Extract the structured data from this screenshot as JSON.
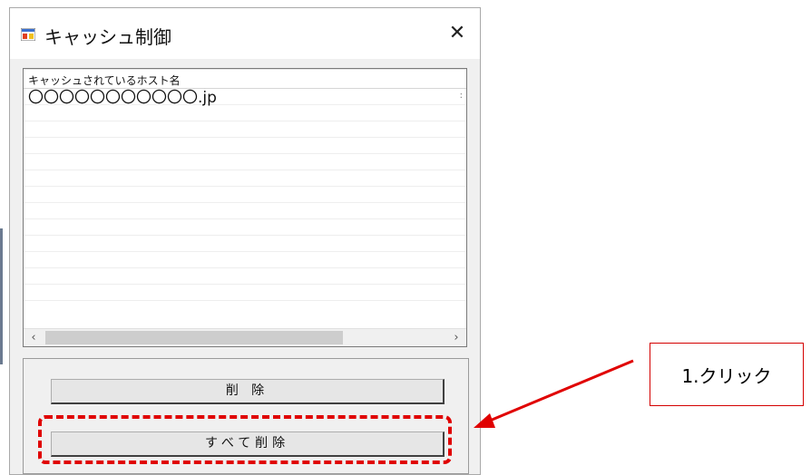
{
  "window": {
    "title": "キャッシュ制御",
    "close_glyph": "✕"
  },
  "list": {
    "column_header": "キャッシュされているホスト名",
    "rows": [
      "〇〇〇〇〇〇〇〇〇〇〇.jp",
      "",
      "",
      "",
      "",
      "",
      "",
      "",
      "",
      "",
      "",
      "",
      ""
    ],
    "row_tail": ":",
    "scroll_left": "‹",
    "scroll_right": "›"
  },
  "buttons": {
    "delete_label": "削 除",
    "delete_all_label": "すべて削除"
  },
  "annotation": {
    "callout_text": "1.クリック",
    "color": "#e00000"
  }
}
